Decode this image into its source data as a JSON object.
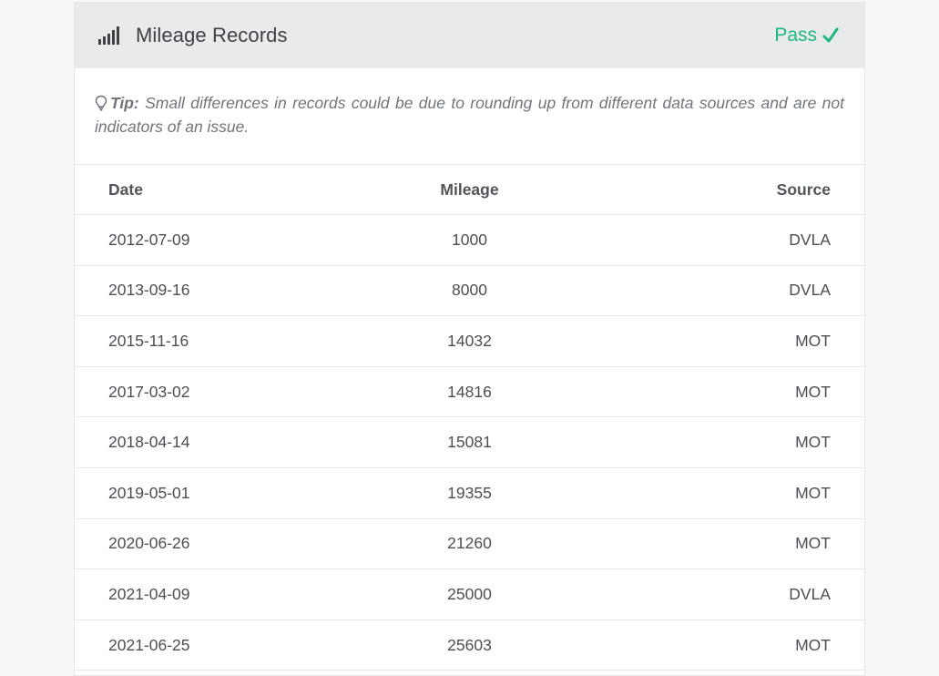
{
  "card": {
    "title": "Mileage Records",
    "status": "Pass",
    "status_color": "#1fb87a"
  },
  "tip": {
    "label": "Tip:",
    "text": " Small differences in records could be due to rounding up from different data sources and are not indicators of an issue."
  },
  "table": {
    "headers": {
      "date": "Date",
      "mileage": "Mileage",
      "source": "Source"
    },
    "rows": [
      {
        "date": "2012-07-09",
        "mileage": "1000",
        "source": "DVLA"
      },
      {
        "date": "2013-09-16",
        "mileage": "8000",
        "source": "DVLA"
      },
      {
        "date": "2015-11-16",
        "mileage": "14032",
        "source": "MOT"
      },
      {
        "date": "2017-03-02",
        "mileage": "14816",
        "source": "MOT"
      },
      {
        "date": "2018-04-14",
        "mileage": "15081",
        "source": "MOT"
      },
      {
        "date": "2019-05-01",
        "mileage": "19355",
        "source": "MOT"
      },
      {
        "date": "2020-06-26",
        "mileage": "21260",
        "source": "MOT"
      },
      {
        "date": "2021-04-09",
        "mileage": "25000",
        "source": "DVLA"
      },
      {
        "date": "2021-06-25",
        "mileage": "25603",
        "source": "MOT"
      }
    ]
  },
  "icons": {
    "header": "signal-bars-icon",
    "status": "check-icon",
    "tip": "lightbulb-icon"
  }
}
